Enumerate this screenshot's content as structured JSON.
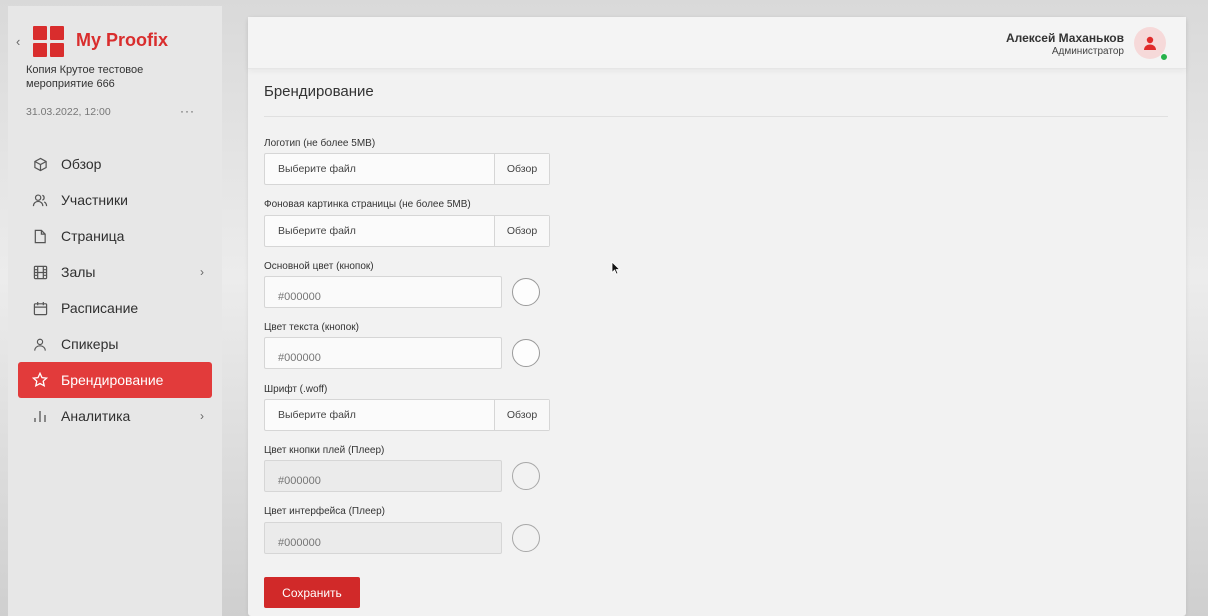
{
  "brand": {
    "name": "My Proofix",
    "color": "#d92d2d"
  },
  "event": {
    "title": "Копия Крутое тестовое мероприятие 666",
    "datetime": "31.03.2022, 12:00",
    "more": "···"
  },
  "nav": {
    "items": [
      {
        "label": "Обзор",
        "icon": "cube-icon"
      },
      {
        "label": "Участники",
        "icon": "users-icon"
      },
      {
        "label": "Страница",
        "icon": "page-icon"
      },
      {
        "label": "Залы",
        "icon": "film-icon",
        "has_submenu": true
      },
      {
        "label": "Расписание",
        "icon": "calendar-icon"
      },
      {
        "label": "Спикеры",
        "icon": "user-icon"
      },
      {
        "label": "Брендирование",
        "icon": "star-icon",
        "active": true
      },
      {
        "label": "Аналитика",
        "icon": "bar-chart-icon",
        "has_submenu": true
      }
    ],
    "active_color": "#e23b3b"
  },
  "user": {
    "name": "Алексей Маханьков",
    "role": "Администратор",
    "status_color": "#27b24a"
  },
  "page": {
    "title": "Брендирование"
  },
  "form": {
    "logo": {
      "label": "Логотип (не более 5MB)",
      "placeholder": "Выберите файл",
      "browse": "Обзор"
    },
    "background": {
      "label": "Фоновая картинка страницы (не более 5MB)",
      "placeholder": "Выберите файл",
      "browse": "Обзор"
    },
    "button_color": {
      "label": "Основной цвет (кнопок)",
      "placeholder": "#000000"
    },
    "button_text_color": {
      "label": "Цвет текста (кнопок)",
      "placeholder": "#000000"
    },
    "font": {
      "label": "Шрифт (.woff)",
      "placeholder": "Выберите файл",
      "browse": "Обзор"
    },
    "play_button_color": {
      "label": "Цвет кнопки плей (Плеер)",
      "placeholder": "#000000"
    },
    "player_ui_color": {
      "label": "Цвет интерфейса (Плеер)",
      "placeholder": "#000000"
    },
    "save_label": "Сохранить",
    "save_color": "#d12929"
  }
}
